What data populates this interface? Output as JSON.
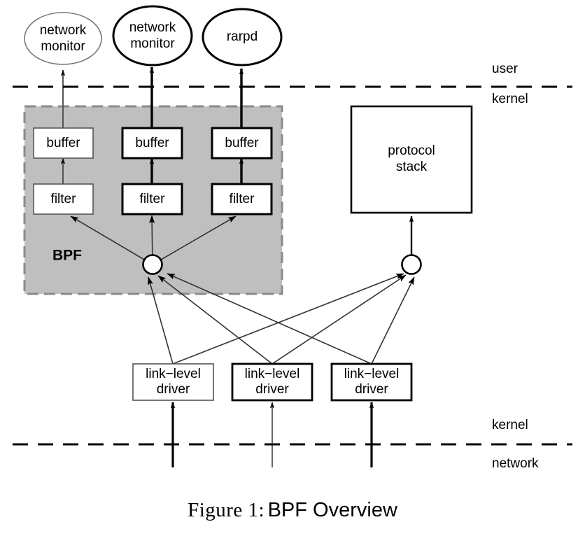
{
  "figure": {
    "caption_prefix": "Figure 1:",
    "caption_title": "BPF Overview"
  },
  "colors": {
    "bpf_region_fill": "#bfbfbf",
    "bpf_region_stroke": "#808080",
    "stroke_dark": "#000000",
    "stroke_light": "#595959",
    "box_fill": "#ffffff",
    "page_background": "#ffffff"
  },
  "boundaries": [
    {
      "id": "user-kernel",
      "above_label": "user",
      "below_label": "kernel"
    },
    {
      "id": "kernel-network",
      "above_label": "kernel",
      "below_label": "network"
    }
  ],
  "region": {
    "label": "BPF"
  },
  "user_processes": [
    {
      "id": "proc-1",
      "line1": "network",
      "line2": "monitor"
    },
    {
      "id": "proc-2",
      "line1": "network",
      "line2": "monitor"
    },
    {
      "id": "proc-3",
      "line1": "rarpd",
      "line2": ""
    }
  ],
  "buffers": [
    {
      "id": "buffer-1",
      "label": "buffer"
    },
    {
      "id": "buffer-2",
      "label": "buffer"
    },
    {
      "id": "buffer-3",
      "label": "buffer"
    }
  ],
  "filters": [
    {
      "id": "filter-1",
      "label": "filter"
    },
    {
      "id": "filter-2",
      "label": "filter"
    },
    {
      "id": "filter-3",
      "label": "filter"
    }
  ],
  "protocol_stack": {
    "line1": "protocol",
    "line2": "stack"
  },
  "drivers": [
    {
      "id": "driver-1",
      "line1": "link−level",
      "line2": "driver"
    },
    {
      "id": "driver-2",
      "line1": "link−level",
      "line2": "driver"
    },
    {
      "id": "driver-3",
      "line1": "link−level",
      "line2": "driver"
    }
  ],
  "taps": [
    {
      "id": "bpf-tap",
      "label": ""
    },
    {
      "id": "protocol-tap",
      "label": ""
    }
  ]
}
